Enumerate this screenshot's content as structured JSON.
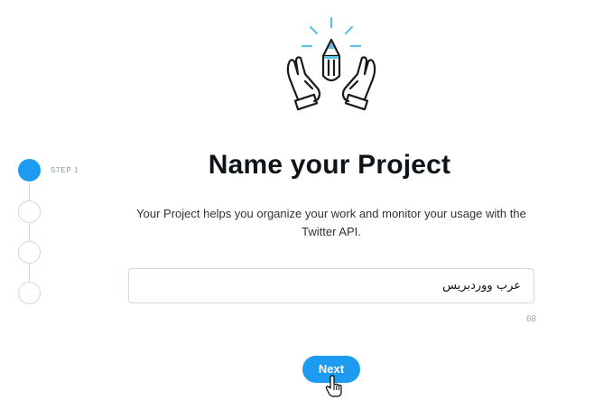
{
  "stepper": {
    "step_label": "STEP 1",
    "current_step": 1,
    "total_steps": 4
  },
  "header": {
    "title": "Name your Project",
    "description": "Your Project helps you organize your work and monitor your usage with the Twitter API."
  },
  "form": {
    "project_name_value": "عرب ووردبريس",
    "remaining_characters": "68"
  },
  "actions": {
    "next_label": "Next"
  },
  "colors": {
    "accent": "#1d9bf0",
    "border": "#cfd9de",
    "text": "#0f1419",
    "illustration_highlight": "#5bc0e8"
  },
  "icons": {
    "illustration": "hands-holding-pencil-icon",
    "cursor": "hand-pointer-icon"
  }
}
